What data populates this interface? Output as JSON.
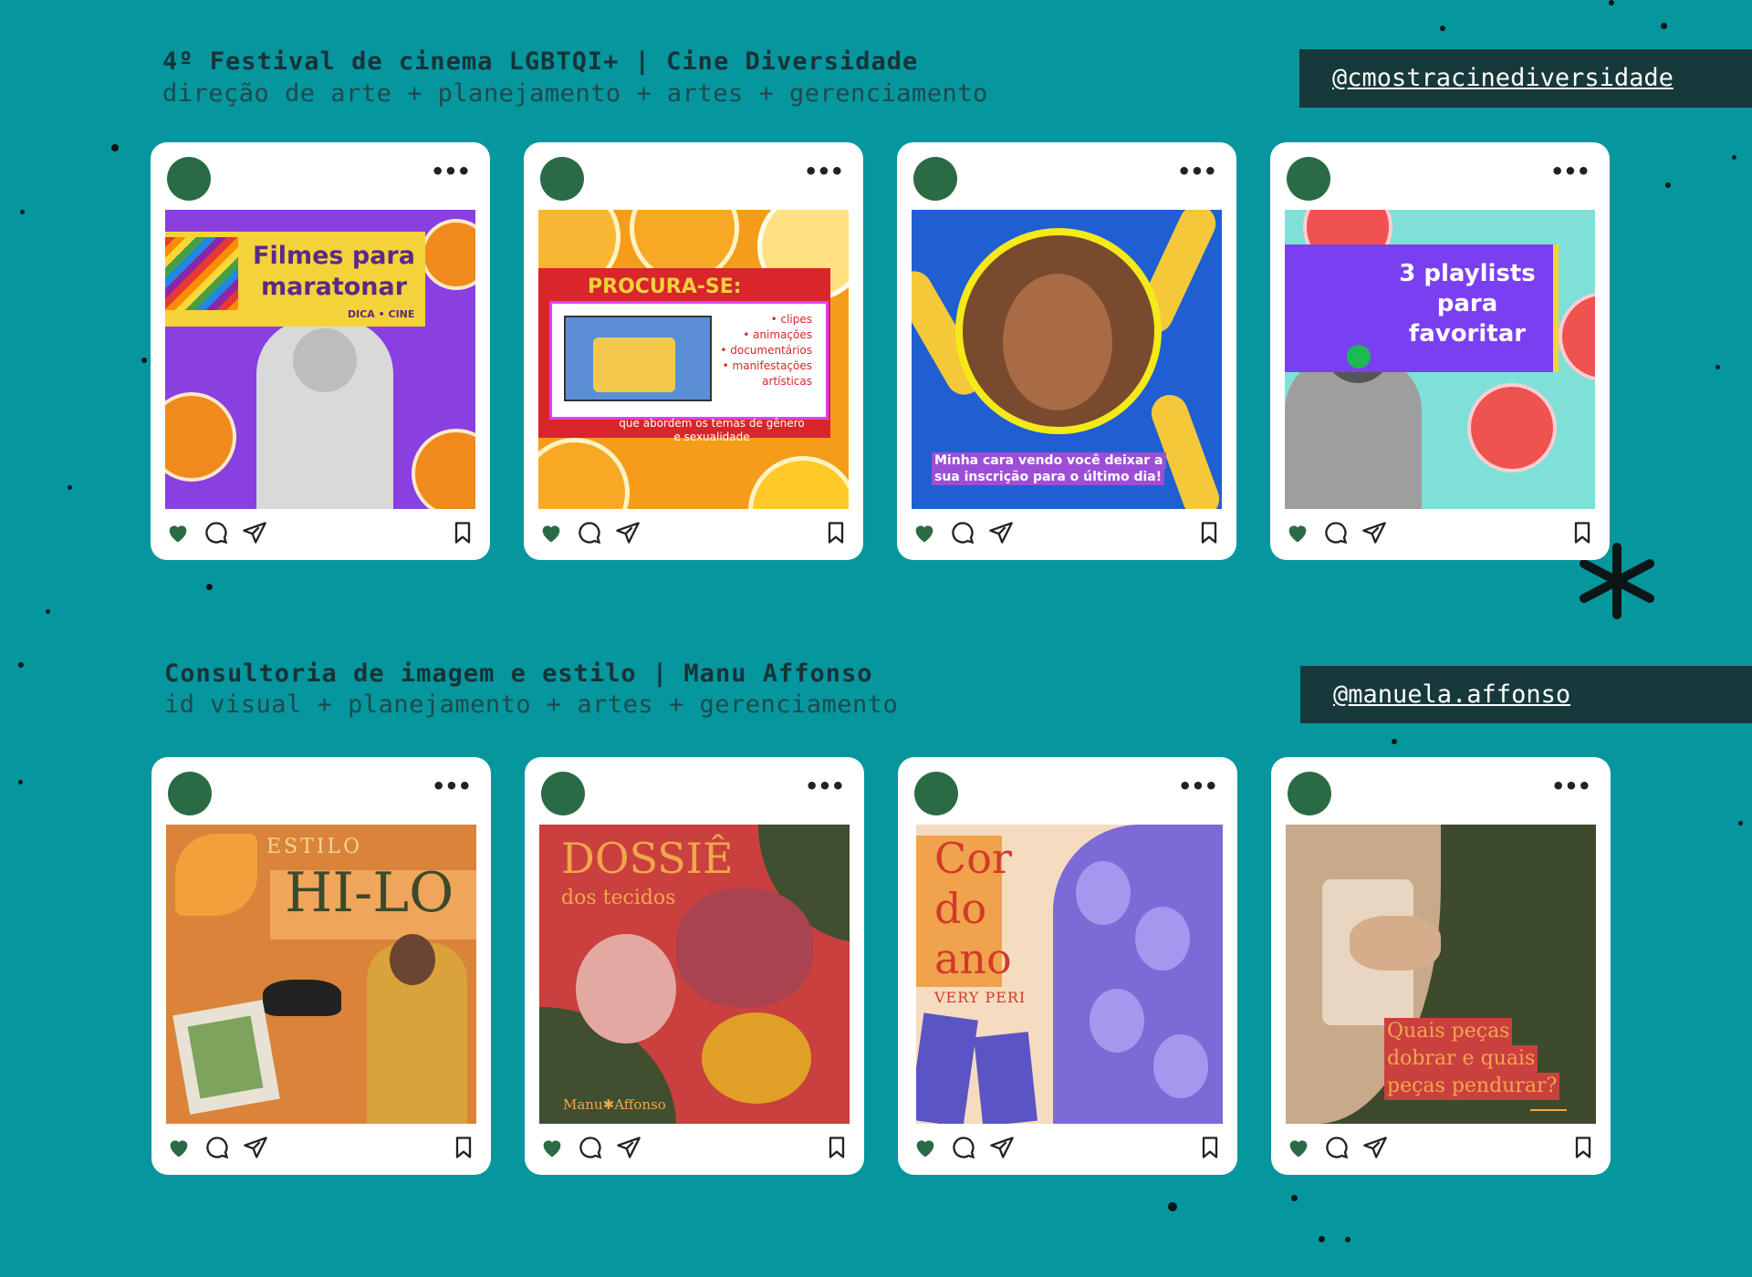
{
  "sections": [
    {
      "title": "4º Festival de cinema LGBTQI+ | Cine Diversidade",
      "subtitle": "direção de arte + planejamento + artes + gerenciamento",
      "handle": "@cmostracinediversidade",
      "posts": [
        {
          "lines": [
            "Filmes para",
            "maratonar"
          ],
          "tag": "DICA • CINE"
        },
        {
          "heading": "PROCURA-SE:",
          "items": [
            "• clipes",
            "• animações",
            "• documentários",
            "• manifestações",
            "artísticas"
          ],
          "footer_lines": [
            "que abordem os temas de gênero",
            "e sexualidade"
          ]
        },
        {
          "caption_lines": [
            "Minha cara vendo você deixar a",
            "sua inscrição para o último dia!"
          ]
        },
        {
          "lines": [
            "3 playlists",
            "para",
            "favoritar"
          ]
        }
      ]
    },
    {
      "title": "Consultoria de imagem e estilo | Manu Affonso",
      "subtitle": "id visual + planejamento + artes + gerenciamento",
      "handle": "@manuela.affonso",
      "posts": [
        {
          "small": "ESTILO",
          "big": "HI-LO"
        },
        {
          "big": "DOSSIÊ",
          "small": "dos tecidos",
          "brand": "Manu✱Affonso"
        },
        {
          "lines": [
            "Cor",
            "do",
            "ano"
          ],
          "small": "VERY PERI"
        },
        {
          "lines": [
            "Quais peças",
            "dobrar e quais",
            "peças pendurar?"
          ]
        }
      ]
    }
  ],
  "icons": {
    "more": "more-dots-icon",
    "like": "heart-icon",
    "comment": "comment-icon",
    "share": "send-icon",
    "save": "bookmark-icon"
  },
  "more_glyph": "•••",
  "colors": {
    "background": "#06969e",
    "card": "#ffffff",
    "avatar": "#2a6b45",
    "handle_bg": "#17393b"
  }
}
